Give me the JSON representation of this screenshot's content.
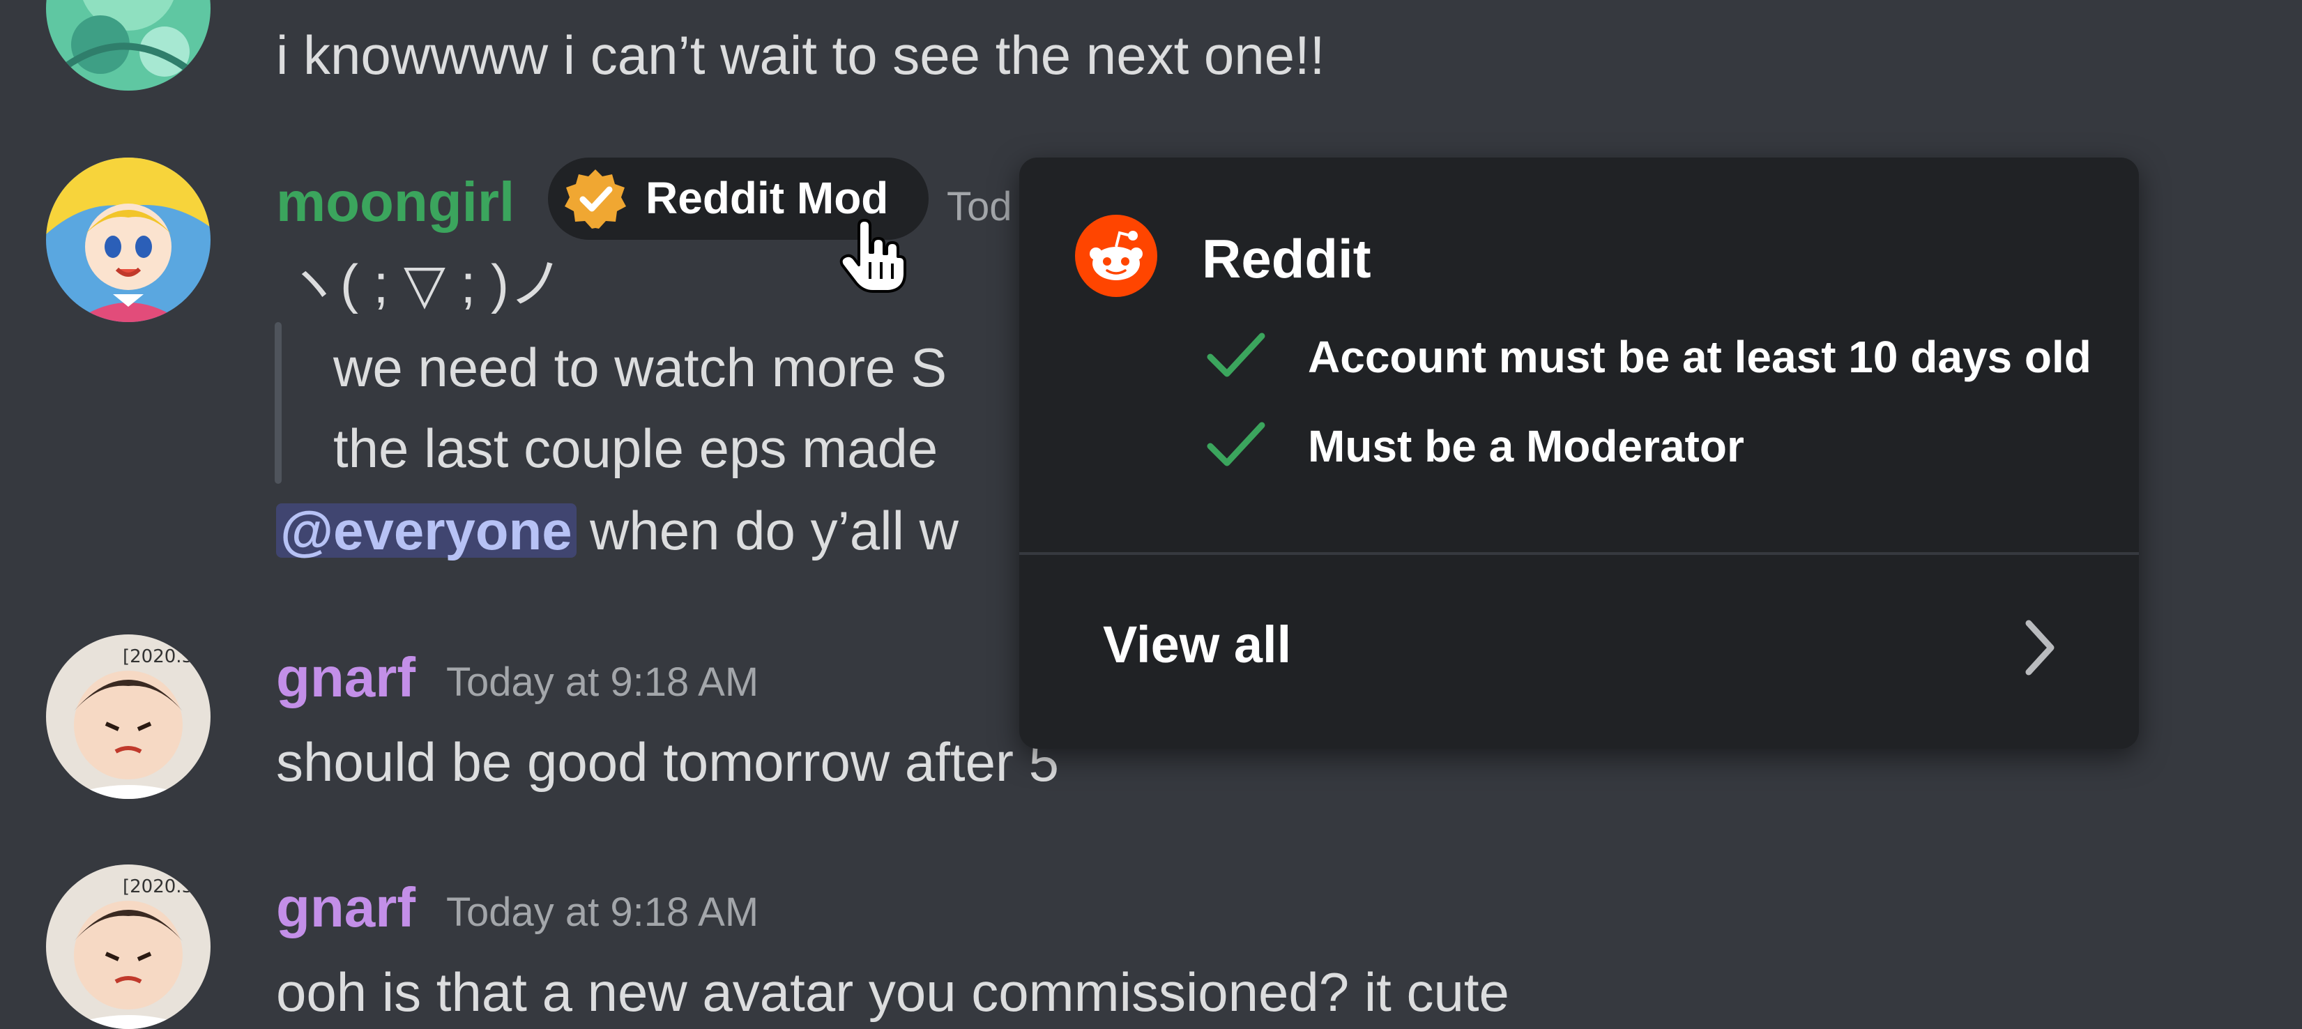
{
  "messages": [
    {
      "text": "i knowwww i can’t wait to see the next one!!"
    },
    {
      "username": "moongirl",
      "username_color": "#3ba55d",
      "badge_label": "Reddit Mod",
      "timestamp": "Tod",
      "lines": [
        "ヽ( ; ▽ ; )ノ",
        "we need to watch more S",
        "the last couple eps made"
      ],
      "mention": "@everyone",
      "mention_text": " when do y’all w"
    },
    {
      "username": "gnarf",
      "username_color": "#c38fe8",
      "timestamp": "Today at 9:18 AM",
      "text": "should be good tomorrow after 5"
    },
    {
      "username": "gnarf",
      "username_color": "#c38fe8",
      "timestamp": "Today at 9:18 AM",
      "text": "ooh is that a new avatar you commissioned? it cute"
    }
  ],
  "popover": {
    "title": "Reddit",
    "icon": "reddit-icon",
    "requirements": [
      {
        "label": "Account must be at least 10 days old",
        "met": true
      },
      {
        "label": "Must be a Moderator",
        "met": true
      }
    ],
    "view_all_label": "View all"
  },
  "colors": {
    "background": "#36393f",
    "popover_bg": "#202225",
    "check_green": "#3ba55d",
    "reddit_orange": "#ff4500",
    "badge_gold": "#f0a732",
    "mention": "#b7c2f5"
  }
}
